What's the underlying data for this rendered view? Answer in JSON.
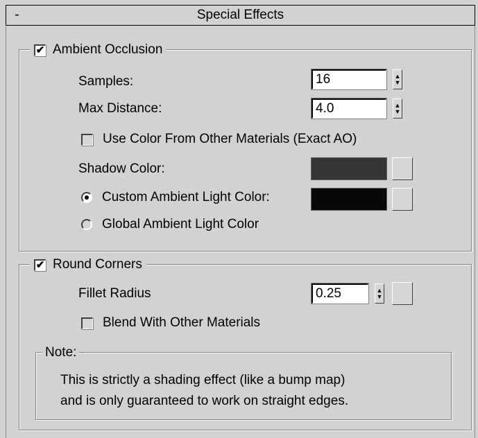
{
  "rollout": {
    "collapse_symbol": "-",
    "title": "Special Effects"
  },
  "ambient_occlusion": {
    "label": "Ambient Occlusion",
    "checked": true,
    "samples_label": "Samples:",
    "samples_value": "16",
    "max_distance_label": "Max Distance:",
    "max_distance_value": "4.0",
    "use_color_label": "Use Color From Other Materials (Exact AO)",
    "use_color_checked": false,
    "shadow_color_label": "Shadow Color:",
    "shadow_color": "#353535",
    "custom_ambient_label": "Custom Ambient Light Color:",
    "custom_ambient_color": "#080808",
    "custom_ambient_selected": true,
    "global_ambient_label": "Global Ambient Light Color"
  },
  "round_corners": {
    "label": "Round Corners",
    "checked": true,
    "fillet_radius_label": "Fillet Radius",
    "fillet_radius_value": "0.25",
    "blend_label": "Blend With Other Materials",
    "blend_checked": false
  },
  "note": {
    "label": "Note:",
    "line1": "This is strictly a shading effect (like a bump map)",
    "line2": "and is only guaranteed to work on straight edges."
  },
  "icons": {
    "check": "✔",
    "spin_up": "▲",
    "spin_down": "▼"
  }
}
